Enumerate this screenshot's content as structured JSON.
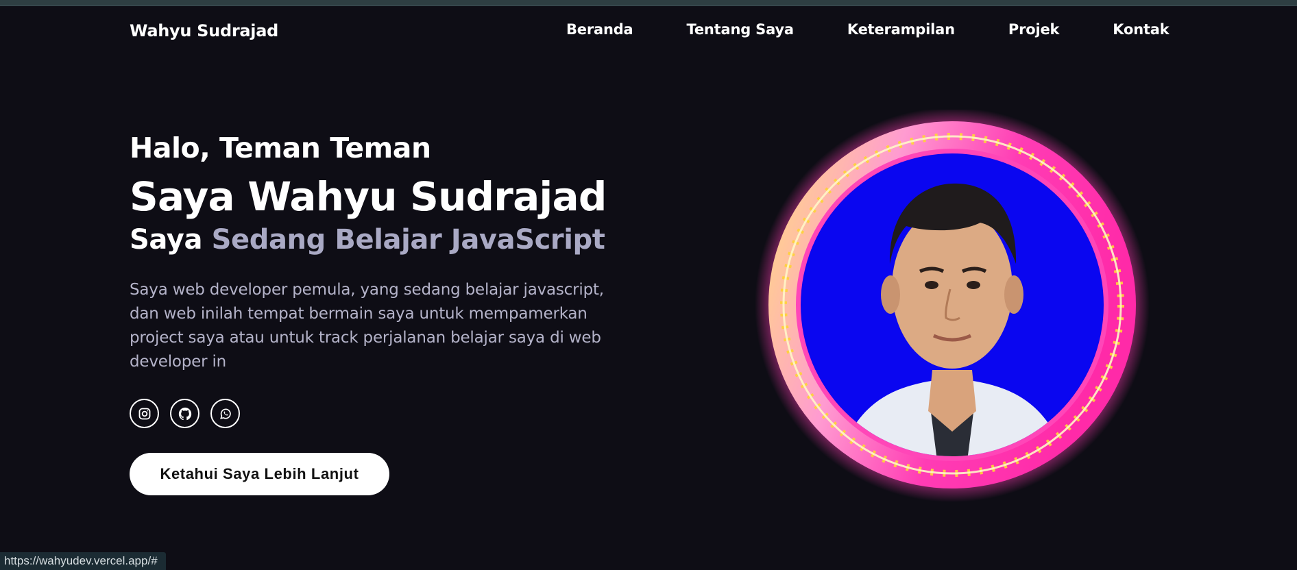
{
  "brand": "Wahyu Sudrajad",
  "nav": [
    "Beranda",
    "Tentang Saya",
    "Keterampilan",
    "Projek",
    "Kontak"
  ],
  "hero": {
    "greeting": "Halo, Teman Teman",
    "name": "Saya Wahyu Sudrajad",
    "learning_prefix": "Saya",
    "learning_accent": "Sedang Belajar JavaScript",
    "description": "Saya web developer pemula, yang sedang belajar javascript, dan web inilah tempat bermain saya untuk mempamerkan project saya atau untuk track perjalanan belajar saya di web developer in",
    "socials": [
      "instagram-icon",
      "github-icon",
      "whatsapp-icon"
    ],
    "cta_label": "Ketahui Saya Lebih Lanjut"
  },
  "status_url": "https://wahyudev.vercel.app/#",
  "colors": {
    "background": "#0e0d15",
    "accent_text": "#a9a9c4",
    "photo_backdrop": "#0a06f0",
    "ring_pink": "#ff3cb4",
    "ring_yellow": "#ffd23c"
  }
}
